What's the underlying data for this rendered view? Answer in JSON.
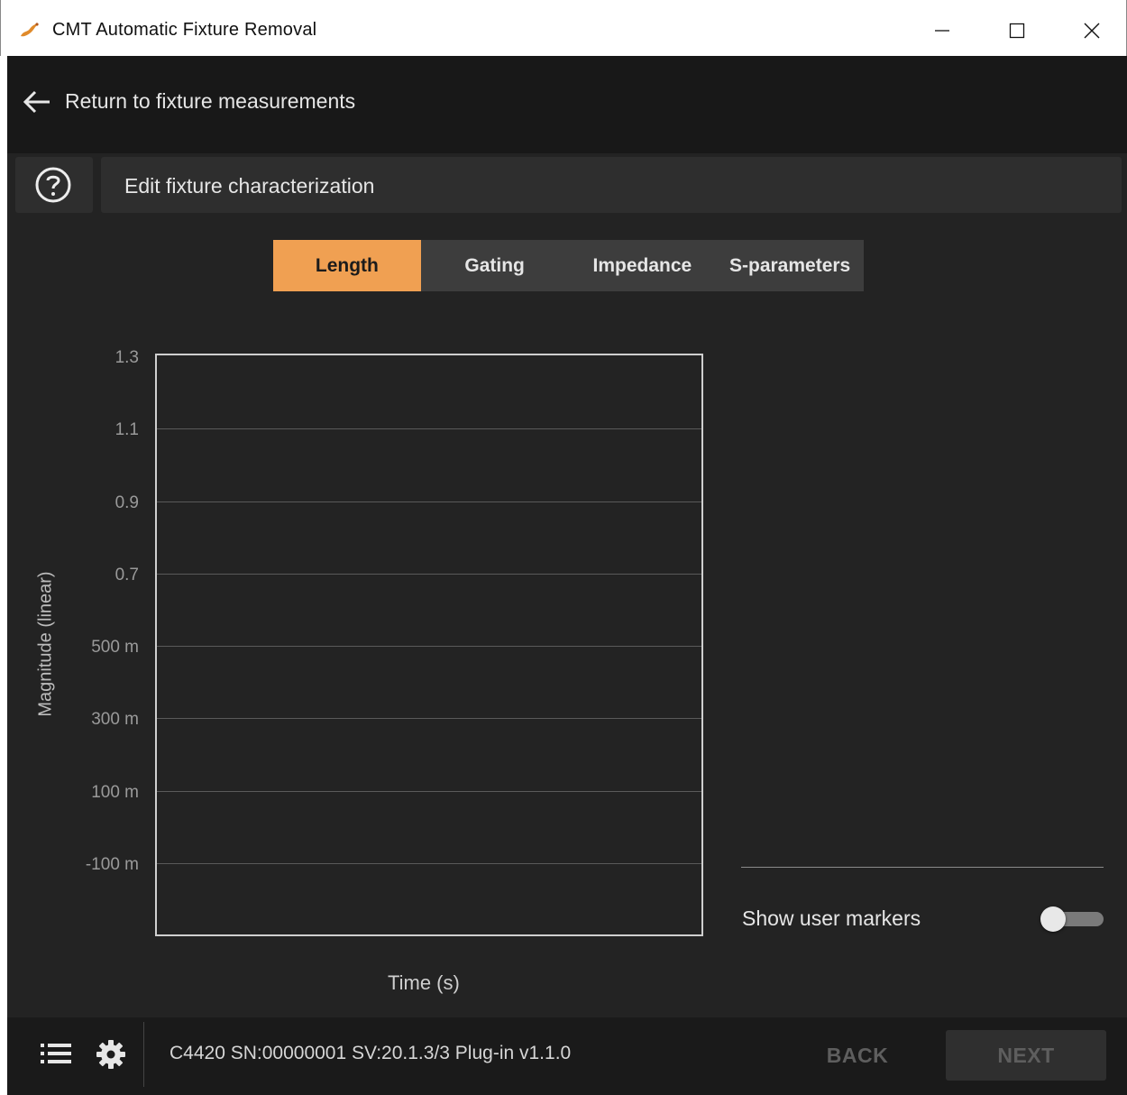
{
  "window": {
    "title": "CMT Automatic Fixture Removal",
    "icon": "dragon-app-icon",
    "controls": [
      "minimize-icon",
      "maximize-icon",
      "close-icon"
    ]
  },
  "topbar": {
    "back_label": "Return to fixture measurements"
  },
  "header": {
    "title": "Edit fixture characterization"
  },
  "tabs": [
    {
      "label": "Length",
      "active": true
    },
    {
      "label": "Gating",
      "active": false
    },
    {
      "label": "Impedance",
      "active": false
    },
    {
      "label": "S-parameters",
      "active": false
    }
  ],
  "chart_data": {
    "type": "line",
    "series": [],
    "xlabel": "Time (s)",
    "ylabel": "Magnitude (linear)",
    "ytick_labels": [
      "1.3",
      "1.1",
      "0.9",
      "0.7",
      "500 m",
      "300 m",
      "100 m",
      "-100 m"
    ],
    "ylim": [
      -0.1,
      1.3
    ],
    "grid": true
  },
  "side_panel": {
    "show_markers_label": "Show user markers",
    "show_markers_value": false
  },
  "footer": {
    "info": "C4420 SN:00000001 SV:20.1.3/3 Plug-in v1.1.0",
    "back_label": "BACK",
    "next_label": "NEXT"
  },
  "colors": {
    "accent": "#f0a052",
    "background": "#232323",
    "panel": "#2e2e2e"
  }
}
